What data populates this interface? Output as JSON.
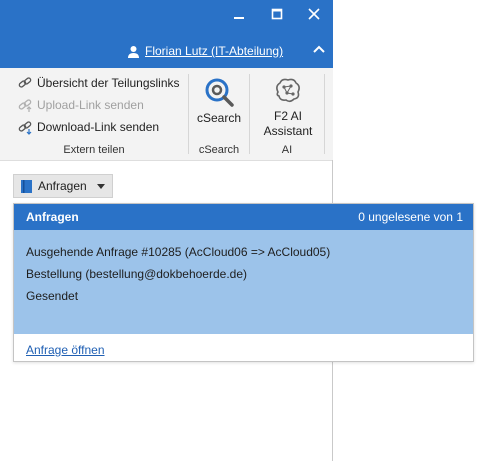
{
  "window": {
    "user_label": "Florian Lutz (IT-Abteilung)"
  },
  "ribbon": {
    "extern_teilen": {
      "items": [
        {
          "label": "Übersicht der Teilungslinks",
          "enabled": true
        },
        {
          "label": "Upload-Link senden",
          "enabled": false
        },
        {
          "label": "Download-Link senden",
          "enabled": true
        }
      ],
      "group_label": "Extern teilen"
    },
    "csearch": {
      "button_label": "cSearch",
      "group_label": "cSearch"
    },
    "ai": {
      "button_label_line1": "F2 AI",
      "button_label_line2": "Assistant",
      "group_label": "AI"
    }
  },
  "toolbar": {
    "anfragen_label": "Anfragen"
  },
  "popup": {
    "title": "Anfragen",
    "unread_count": "0 ungelesene von 1",
    "request": {
      "line1": "Ausgehende Anfrage #10285 (AcCloud06 => AcCloud05)",
      "line2": "Bestellung (bestellung@dokbehoerde.de)",
      "line3": "Gesendet"
    },
    "open_link": "Anfrage öffnen"
  },
  "colors": {
    "accent": "#2a72c7",
    "selected_row": "#9cc3ea",
    "link": "#1f5fb3"
  }
}
